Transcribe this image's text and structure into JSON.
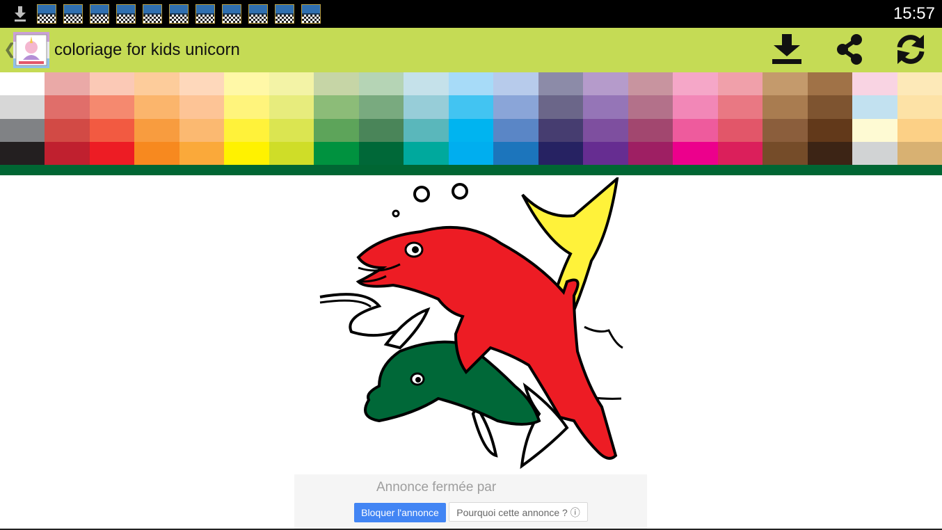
{
  "status_bar": {
    "time": "15:57",
    "download_icon": "download-arrow-icon",
    "notification_icon": "fixed-matches-app-icon",
    "notification_count": 11
  },
  "app_bar": {
    "back_icon": "chevron-left-icon",
    "logo_icon": "unicorn-app-logo",
    "title": "coloriage for kids unicorn",
    "actions": [
      {
        "name": "download-button",
        "icon": "download-tray-icon"
      },
      {
        "name": "share-button",
        "icon": "share-icon"
      },
      {
        "name": "refresh-button",
        "icon": "refresh-icon"
      }
    ],
    "color": "#c5db55"
  },
  "palette": {
    "columns": [
      [
        "#ffffff",
        "#d7d7d7",
        "#808285",
        "#231f20"
      ],
      [
        "#eaa9a7",
        "#e06e6a",
        "#d24a45",
        "#c0202f"
      ],
      [
        "#fbc9b6",
        "#f5896f",
        "#f25a41",
        "#ed1c24"
      ],
      [
        "#fdcc9b",
        "#fbb56c",
        "#f89c3f",
        "#f7891f"
      ],
      [
        "#fed8bb",
        "#fdc496",
        "#fbb971",
        "#faa93a"
      ],
      [
        "#fff8a7",
        "#fff47c",
        "#fff23a",
        "#fff200"
      ],
      [
        "#f3f3a6",
        "#e7ec7d",
        "#dbe551",
        "#cfdd28"
      ],
      [
        "#c6d5a6",
        "#8cbc78",
        "#5da45a",
        "#00923f"
      ],
      [
        "#b5d4b5",
        "#79aa7f",
        "#4a8559",
        "#006838"
      ],
      [
        "#c5e1ea",
        "#97cdd8",
        "#5ab7bb",
        "#00a99d"
      ],
      [
        "#a7dbf8",
        "#42c4f2",
        "#00b4f0",
        "#00aeef"
      ],
      [
        "#b7cbeb",
        "#8aa5d8",
        "#5a86c6",
        "#1c75bc"
      ],
      [
        "#8c8ba8",
        "#6b6689",
        "#463d70",
        "#262262"
      ],
      [
        "#b59bcb",
        "#9575b7",
        "#7e4f9f",
        "#662d91"
      ],
      [
        "#c8949f",
        "#b3718a",
        "#a2476f",
        "#9e1f63"
      ],
      [
        "#f5a7c8",
        "#f287b7",
        "#ee5b9d",
        "#ec008c"
      ],
      [
        "#f0a0aa",
        "#e97883",
        "#e25669",
        "#db1f5b"
      ],
      [
        "#c49a6c",
        "#a97c50",
        "#8b5e3c",
        "#754c29"
      ],
      [
        "#a07247",
        "#7e5430",
        "#62391a",
        "#3c2415"
      ],
      [
        "#f9d4e3",
        "#c2e1f0",
        "#fefad3",
        "#d1d3d4"
      ],
      [
        "#fde9b8",
        "#fde2a6",
        "#fcd086",
        "#d8b172"
      ]
    ],
    "strip_color": "#006633"
  },
  "canvas": {
    "subject": "dolphins-coloring-page",
    "fill_colors": {
      "red_dolphin": "#ed1c24",
      "green_dolphin": "#006838",
      "tail": "#fff23a"
    }
  },
  "ad": {
    "closed_label": "Annonce fermée par",
    "block_button": "Bloquer l'annonce",
    "why_button": "Pourquoi cette annonce ? ⓘ"
  }
}
